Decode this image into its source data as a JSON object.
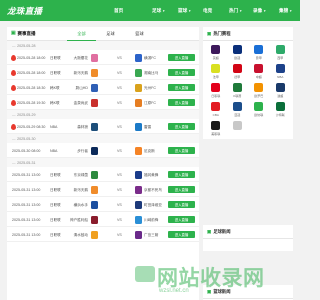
{
  "header": {
    "logo": "龙珠直播",
    "nav": [
      {
        "label": "首页",
        "caret": false
      },
      {
        "label": "足球",
        "caret": true
      },
      {
        "label": "篮球",
        "caret": true
      },
      {
        "label": "电竞",
        "caret": false
      },
      {
        "label": "热门",
        "caret": true
      },
      {
        "label": "录像",
        "caret": true
      },
      {
        "label": "集锦",
        "caret": true
      }
    ]
  },
  "main": {
    "title": "赛事直播",
    "tabs": [
      "全部",
      "足球",
      "篮球"
    ],
    "active_tab": 0,
    "live_label": "进入直播",
    "vs_label": "VS",
    "dates": [
      "2025-05-28",
      "2025-05-29",
      "2025-05-30",
      "2025-05-31"
    ],
    "matches": [
      {
        "fire": true,
        "time": "2025-05-28 18:00",
        "league": "日职联",
        "home": "大阪樱花",
        "away": "横滨FC",
        "c1": "#e06fa0",
        "c2": "#2c63c9"
      },
      {
        "fire": true,
        "time": "2025-05-28 18:00",
        "league": "日职联",
        "home": "新泻天鹅",
        "away": "湘南比马",
        "c1": "#f08c2a",
        "c2": "#3aa852"
      },
      {
        "fire": true,
        "time": "2025-05-28 18:30",
        "league": "韩K联",
        "home": "蔚山HD",
        "away": "光州FC",
        "c1": "#2f5fb5",
        "c2": "#d9a21c"
      },
      {
        "fire": true,
        "time": "2025-05-28 19:30",
        "league": "韩K联",
        "home": "金泉尚武",
        "away": "江原FC",
        "c1": "#c9302c",
        "c2": "#e67e22"
      },
      {
        "fire": true,
        "time": "2025-05-29 08:30",
        "league": "NBA",
        "home": "森林狼",
        "away": "雷霆",
        "c1": "#1d4e7a",
        "c2": "#1b7ac7"
      },
      {
        "fire": false,
        "time": "2025-05-30 08:00",
        "league": "NBA",
        "home": "步行者",
        "away": "尼克斯",
        "c1": "#0c2a5a",
        "c2": "#f58426"
      },
      {
        "fire": false,
        "time": "2025-05-31 13:00",
        "league": "日职联",
        "home": "东京绿茵",
        "away": "福冈黄蜂",
        "c1": "#2d8a3e",
        "c2": "#1b3c8a"
      },
      {
        "fire": false,
        "time": "2025-05-31 13:00",
        "league": "日职联",
        "home": "新泻天鹅",
        "away": "京都不死鸟",
        "c1": "#f08c2a",
        "c2": "#7a2c8a"
      },
      {
        "fire": false,
        "time": "2025-05-31 13:00",
        "league": "日职联",
        "home": "横浜水手",
        "away": "町田泽维亚",
        "c1": "#1c4fa0",
        "c2": "#1d3a7a"
      },
      {
        "fire": false,
        "time": "2025-05-31 13:00",
        "league": "日职联",
        "home": "神户胜利船",
        "away": "川崎前锋",
        "c1": "#8a1c2c",
        "c2": "#2a8fd6"
      },
      {
        "fire": false,
        "time": "2025-05-31 13:00",
        "league": "日职联",
        "home": "清水鼓动",
        "away": "广岛三箭",
        "c1": "#f0a020",
        "c2": "#6a2a8a"
      }
    ]
  },
  "sidebar": {
    "leagues_title": "热门赛程",
    "leagues": [
      {
        "name": "英超",
        "color": "#3d195b"
      },
      {
        "name": "欧冠",
        "color": "#0a2f7a"
      },
      {
        "name": "意甲",
        "color": "#1a6fd6"
      },
      {
        "name": "西甲",
        "color": "#2eaa6a"
      },
      {
        "name": "法甲",
        "color": "#d9e021"
      },
      {
        "name": "德甲",
        "color": "#d20515"
      },
      {
        "name": "中超",
        "color": "#c8102e"
      },
      {
        "name": "NBA",
        "color": "#1d428a"
      },
      {
        "name": "日职联",
        "color": "#e3001b"
      },
      {
        "name": "K联赛",
        "color": "#1f7a3a"
      },
      {
        "name": "欧罗巴",
        "color": "#f39200"
      },
      {
        "name": "澳超",
        "color": "#1a3a6a"
      },
      {
        "name": "CBA",
        "color": "#e31b23"
      },
      {
        "name": "亚冠",
        "color": "#1b4d8a"
      },
      {
        "name": "欧协联",
        "color": "#2db24c"
      },
      {
        "name": "沙特联",
        "color": "#0b6f3a"
      },
      {
        "name": "美职联",
        "color": "#1a1a1a"
      },
      {
        "name": "",
        "color": "#c8c8c8"
      }
    ],
    "section2_title": "足球新闻",
    "section3_title": "篮球新闻"
  },
  "watermark": {
    "text": "网站收录网",
    "sub": "wzsl.net.cn"
  }
}
